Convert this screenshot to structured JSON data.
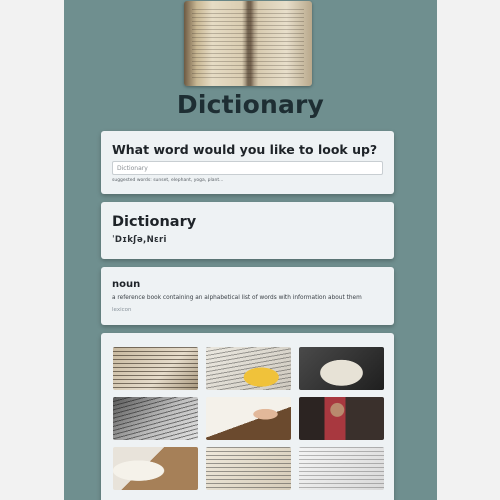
{
  "header": {
    "title": "Dictionary",
    "hero_icon": "open-book-photo"
  },
  "search": {
    "heading": "What word would you like to look up?",
    "placeholder": "Dictionary",
    "value": "",
    "suggestions": "suggested words: sunset, elephant, yoga, plant..."
  },
  "result": {
    "word": "Dictionary",
    "phonetic": "ˈDɪkʃə,Nɛri"
  },
  "meaning": {
    "part_of_speech": "noun",
    "definition": "a reference book containing an alphabetical list of words with information about them",
    "synonym": "lexicon"
  },
  "gallery": {
    "images": [
      "dictionary-page-closeup",
      "dictionary-with-yellow-flower",
      "open-book-dark-background",
      "dictionary-text-bw",
      "person-reading-book",
      "person-holding-red-book",
      "hands-with-book",
      "dictionary-with-pen",
      "dictionary-pages"
    ]
  },
  "colors": {
    "background": "#6f8f8f",
    "card": "#eef2f4",
    "title": "#1e2e33"
  }
}
